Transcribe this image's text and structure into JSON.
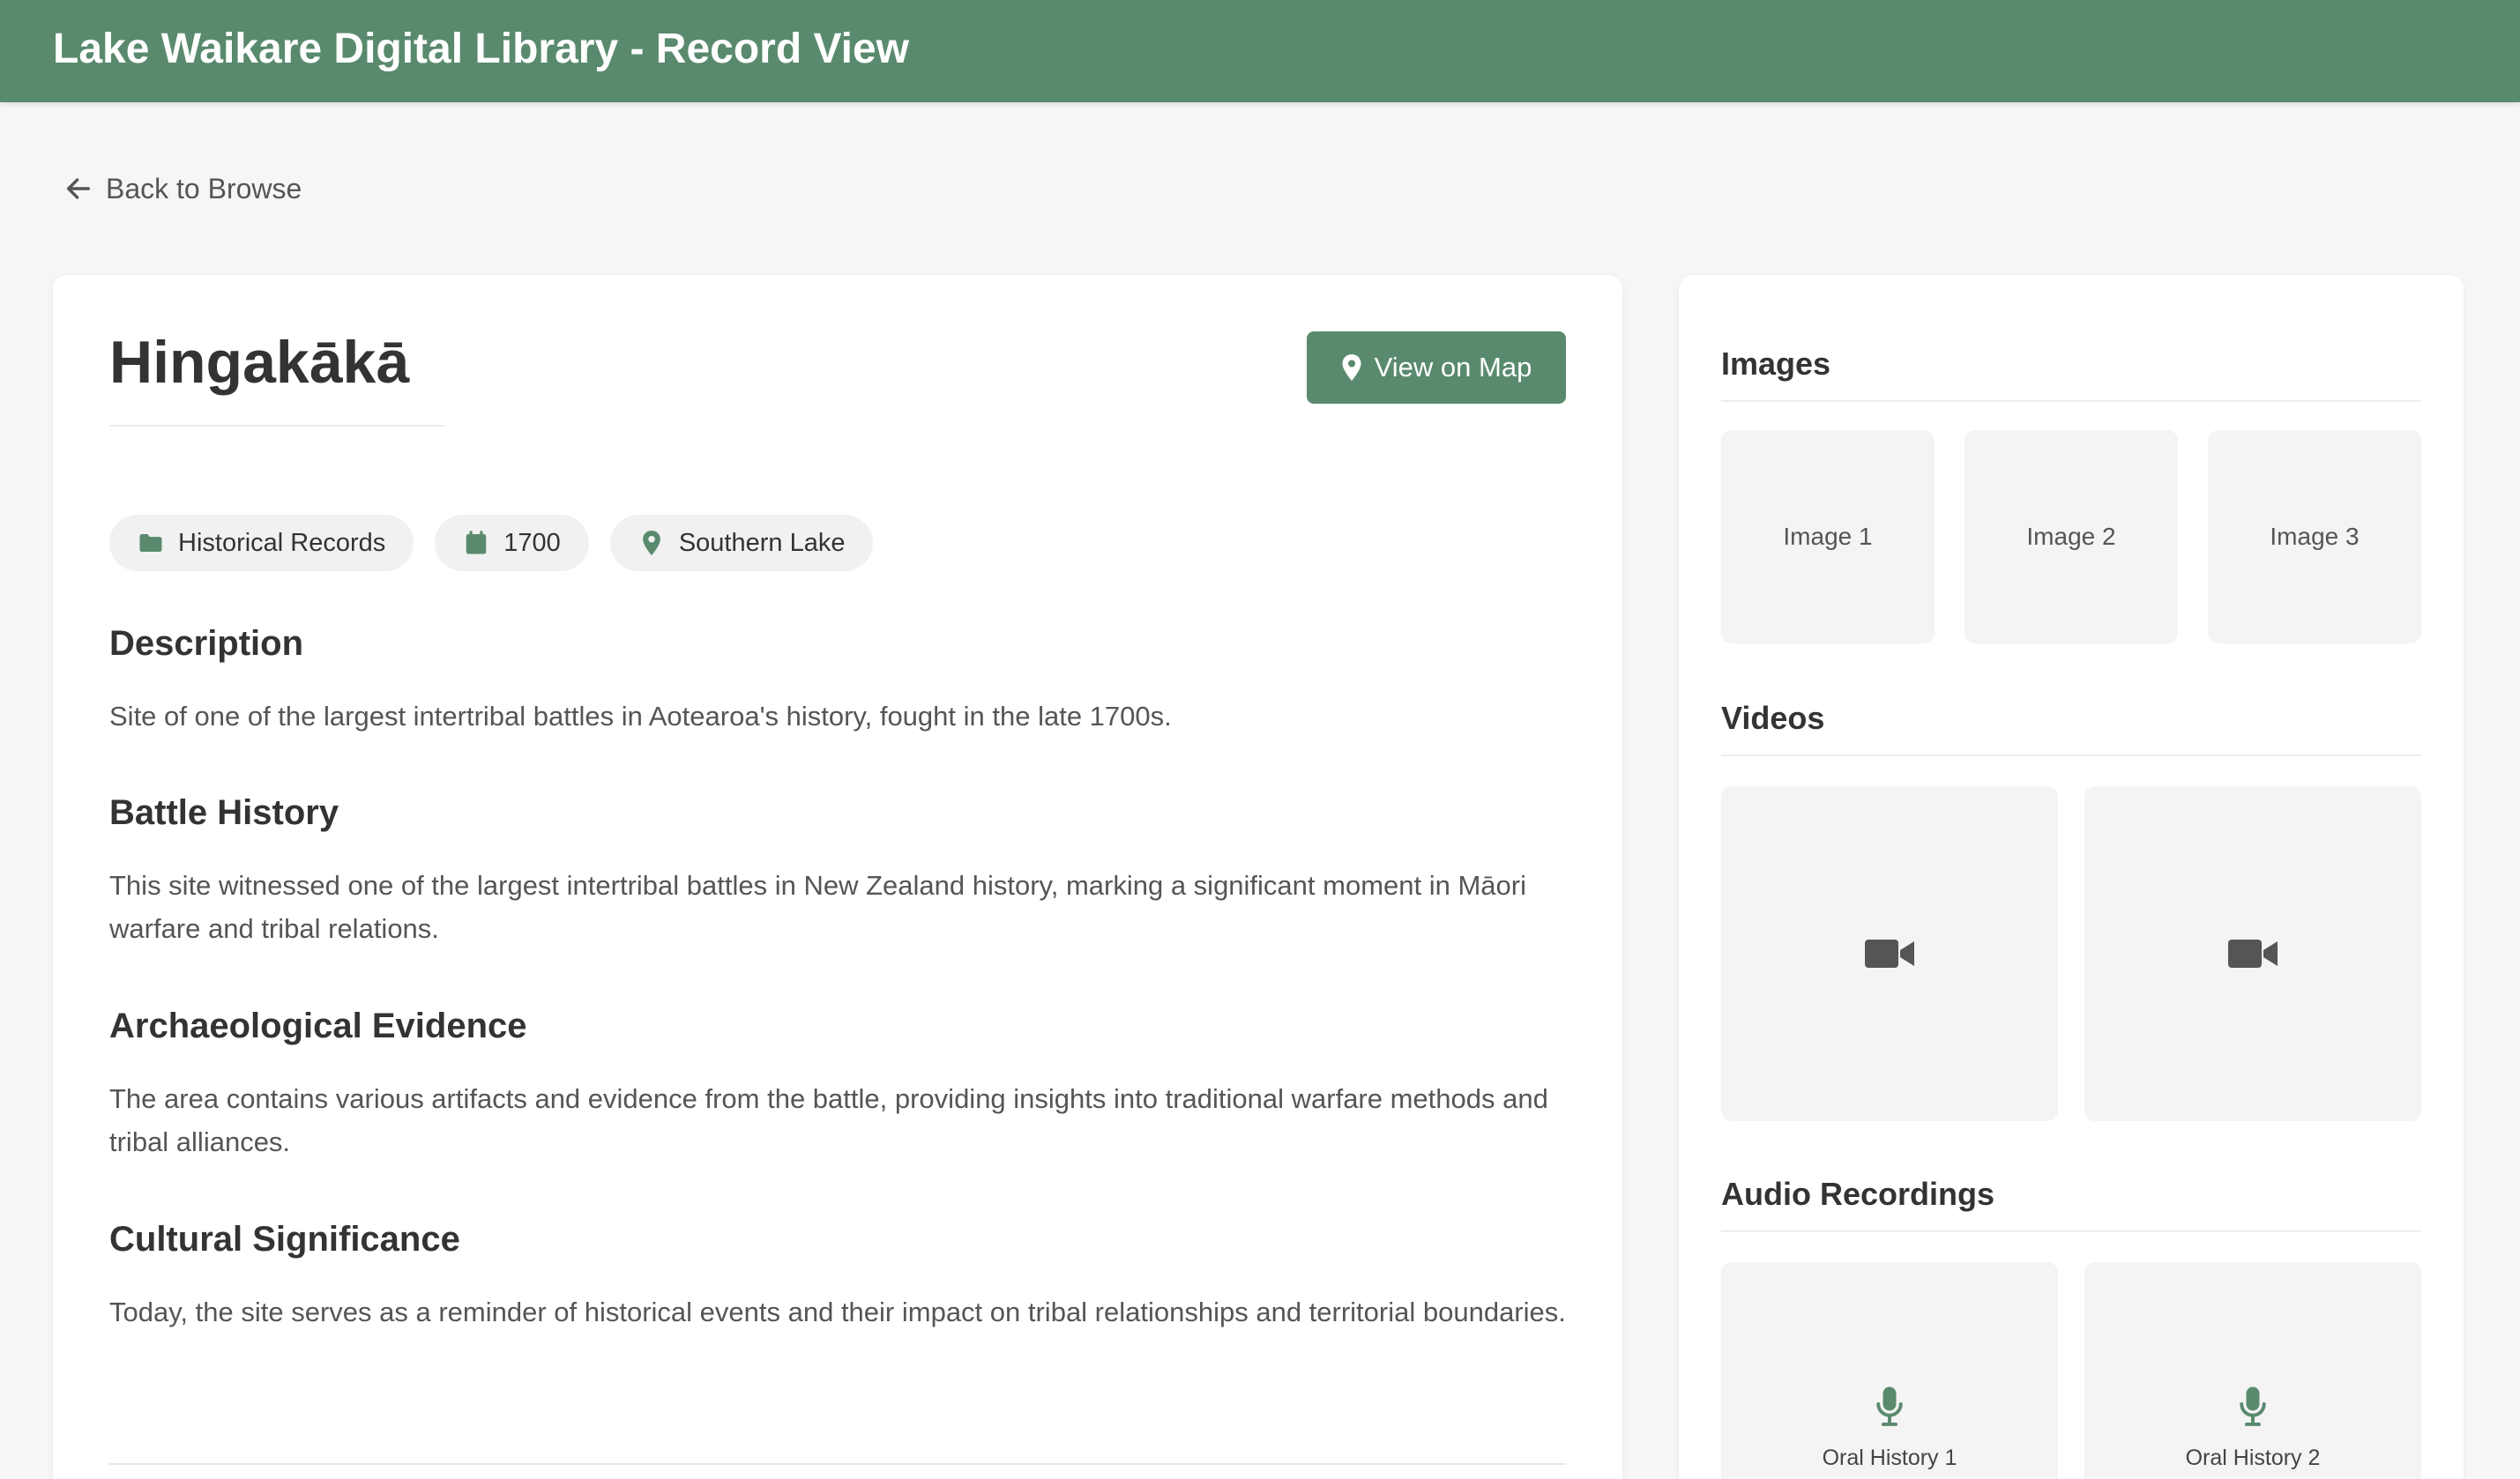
{
  "app": {
    "title": "Lake Waikare Digital Library - Record View"
  },
  "nav": {
    "back_label": "Back to Browse"
  },
  "record": {
    "title": "Hingakākā",
    "map_button_label": "View on Map",
    "tags": [
      {
        "icon": "folder-icon",
        "label": "Historical Records"
      },
      {
        "icon": "calendar-icon",
        "label": "1700"
      },
      {
        "icon": "map-pin-icon",
        "label": "Southern Lake"
      }
    ],
    "sections": [
      {
        "heading": "Description",
        "text": "Site of one of the largest intertribal battles in Aotearoa's history, fought in the late 1700s."
      },
      {
        "heading": "Battle History",
        "text": "This site witnessed one of the largest intertribal battles in New Zealand history, marking a significant moment in Māori warfare and tribal relations."
      },
      {
        "heading": "Archaeological Evidence",
        "text": "The area contains various artifacts and evidence from the battle, providing insights into traditional warfare methods and tribal alliances."
      },
      {
        "heading": "Cultural Significance",
        "text": "Today, the site serves as a reminder of historical events and their impact on tribal relationships and territorial boundaries."
      }
    ]
  },
  "media": {
    "images_heading": "Images",
    "images": [
      "Image 1",
      "Image 2",
      "Image 3"
    ],
    "videos_heading": "Videos",
    "videos": [
      "video-camera-icon",
      "video-camera-icon"
    ],
    "audio_heading": "Audio Recordings",
    "audio": [
      "Oral History 1",
      "Oral History 2"
    ]
  },
  "colors": {
    "brand_green": "#5a8a6e",
    "page_background": "#f6f6f6",
    "card_background": "#ffffff",
    "thumb_background": "#f4f4f4",
    "tag_background": "#f1f1f1"
  }
}
